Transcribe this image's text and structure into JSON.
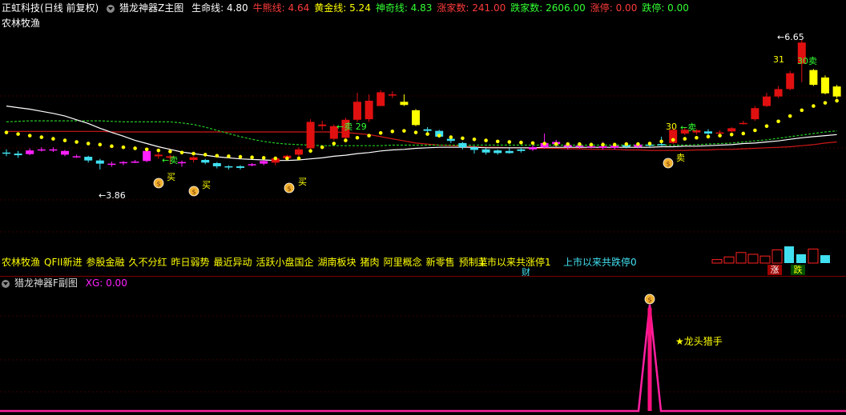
{
  "main_header": {
    "stock": "正虹科技",
    "period": "(日线 前复权)",
    "indicator": "猎龙神器Z主图",
    "items": [
      {
        "text": "生命线: 4.80",
        "color": "#ffffff"
      },
      {
        "text": "牛熊线: 4.64",
        "color": "#ff3b3b"
      },
      {
        "text": "黄金线: 5.24",
        "color": "#ffff00"
      },
      {
        "text": "神奇线: 4.83",
        "color": "#33ff33"
      },
      {
        "text": "涨家数: 241.00",
        "color": "#ff3b3b"
      },
      {
        "text": "跌家数: 2606.00",
        "color": "#33ff33"
      },
      {
        "text": "涨停: 0.00",
        "color": "#ff3b3b"
      },
      {
        "text": "跌停: 0.00",
        "color": "#33ff33"
      }
    ],
    "sector": "农林牧渔"
  },
  "tags": {
    "first": "农林牧渔",
    "concepts": [
      "QFII新进",
      "参股金融",
      "久不分红",
      "昨日弱势",
      "最近异动",
      "活跃小盘国企",
      "湖南板块",
      "猪肉",
      "阿里概念",
      "新零售",
      "预制菜"
    ],
    "limit_up_total": "上市以来共涨停1",
    "limit_down_total": "上市以来共跌停0",
    "cai": "财",
    "zhang": "涨",
    "die": "跌"
  },
  "sub_header": {
    "indicator": "猎龙神器F副图",
    "xg": "XG: 0.00"
  },
  "annotations": {
    "low_price": "←3.86",
    "high_price": "←6.65",
    "sell_29": "←卖 29",
    "sell_30_left": "30",
    "sell_30_left_label": "←卖",
    "sell_30_right": "30卖",
    "num_31": "31",
    "buy": "买",
    "sell_small": "卖",
    "dragon_hunter": "★龙头猎手",
    "money_bag_glyph": "$"
  },
  "colors": {
    "up": "#e01010",
    "down": "#40e0f0",
    "magenta": "#ff20ff",
    "yellow": "#ffff00",
    "white": "#ffffff",
    "green": "#33ff33",
    "red": "#ff2020"
  },
  "chart_data": {
    "type": "candlestick",
    "price_range": [
      3.7,
      6.8
    ],
    "candles": [
      {
        "o": 4.52,
        "c": 4.52,
        "h": 4.58,
        "l": 4.45,
        "k": "down"
      },
      {
        "o": 4.5,
        "c": 4.47,
        "h": 4.55,
        "l": 4.42,
        "k": "down"
      },
      {
        "o": 4.49,
        "c": 4.56,
        "h": 4.6,
        "l": 4.47,
        "k": "magenta"
      },
      {
        "o": 4.56,
        "c": 4.58,
        "h": 4.62,
        "l": 4.54,
        "k": "magenta"
      },
      {
        "o": 4.58,
        "c": 4.56,
        "h": 4.62,
        "l": 4.53,
        "k": "magenta"
      },
      {
        "o": 4.55,
        "c": 4.48,
        "h": 4.57,
        "l": 4.45,
        "k": "magenta"
      },
      {
        "o": 4.45,
        "c": 4.45,
        "h": 4.48,
        "l": 4.42,
        "k": "magenta"
      },
      {
        "o": 4.44,
        "c": 4.37,
        "h": 4.46,
        "l": 4.33,
        "k": "down"
      },
      {
        "o": 4.37,
        "c": 4.31,
        "h": 4.4,
        "l": 4.2,
        "k": "down"
      },
      {
        "o": 4.31,
        "c": 4.31,
        "h": 4.35,
        "l": 4.25,
        "k": "magenta"
      },
      {
        "o": 4.32,
        "c": 4.34,
        "h": 4.36,
        "l": 4.28,
        "k": "magenta"
      },
      {
        "o": 4.35,
        "c": 4.35,
        "h": 4.38,
        "l": 4.32,
        "k": "magenta"
      },
      {
        "o": 4.36,
        "c": 4.55,
        "h": 4.58,
        "l": 4.34,
        "k": "magenta"
      },
      {
        "o": 4.48,
        "c": 4.45,
        "h": 4.52,
        "l": 4.4,
        "k": "up"
      },
      {
        "o": 4.45,
        "c": 4.42,
        "h": 4.48,
        "l": 4.3,
        "k": "up"
      },
      {
        "o": 4.34,
        "c": 4.32,
        "h": 4.37,
        "l": 4.25,
        "k": "magenta"
      },
      {
        "o": 4.38,
        "c": 4.43,
        "h": 4.45,
        "l": 4.33,
        "k": "up"
      },
      {
        "o": 4.38,
        "c": 4.33,
        "h": 4.4,
        "l": 4.3,
        "k": "down"
      },
      {
        "o": 4.32,
        "c": 4.26,
        "h": 4.34,
        "l": 4.22,
        "k": "down"
      },
      {
        "o": 4.26,
        "c": 4.24,
        "h": 4.28,
        "l": 4.2,
        "k": "down"
      },
      {
        "o": 4.23,
        "c": 4.26,
        "h": 4.28,
        "l": 4.2,
        "k": "down"
      },
      {
        "o": 4.28,
        "c": 4.3,
        "h": 4.32,
        "l": 4.26,
        "k": "magenta"
      },
      {
        "o": 4.31,
        "c": 4.36,
        "h": 4.38,
        "l": 4.28,
        "k": "magenta"
      },
      {
        "o": 4.33,
        "c": 4.41,
        "h": 4.43,
        "l": 4.28,
        "k": "up"
      },
      {
        "o": 4.41,
        "c": 4.46,
        "h": 4.48,
        "l": 4.38,
        "k": "up"
      },
      {
        "o": 4.48,
        "c": 4.58,
        "h": 4.62,
        "l": 4.45,
        "k": "up"
      },
      {
        "o": 4.6,
        "c": 5.1,
        "h": 5.15,
        "l": 4.58,
        "k": "up"
      },
      {
        "o": 5.05,
        "c": 5.02,
        "h": 5.12,
        "l": 4.95,
        "k": "up"
      },
      {
        "o": 5.02,
        "c": 4.78,
        "h": 5.05,
        "l": 4.75,
        "k": "up"
      },
      {
        "o": 4.8,
        "c": 5.14,
        "h": 5.18,
        "l": 4.78,
        "k": "up"
      },
      {
        "o": 5.14,
        "c": 5.48,
        "h": 5.65,
        "l": 5.1,
        "k": "up"
      },
      {
        "o": 5.15,
        "c": 5.5,
        "h": 5.62,
        "l": 5.1,
        "k": "up"
      },
      {
        "o": 5.4,
        "c": 5.66,
        "h": 5.7,
        "l": 5.4,
        "k": "up"
      },
      {
        "o": 5.62,
        "c": 5.62,
        "h": 5.68,
        "l": 5.55,
        "k": "up"
      },
      {
        "o": 5.48,
        "c": 5.42,
        "h": 5.62,
        "l": 5.4,
        "k": "yellow"
      },
      {
        "o": 5.32,
        "c": 5.04,
        "h": 5.34,
        "l": 5.02,
        "k": "yellow"
      },
      {
        "o": 4.96,
        "c": 4.93,
        "h": 5.0,
        "l": 4.85,
        "k": "down"
      },
      {
        "o": 4.93,
        "c": 4.82,
        "h": 4.95,
        "l": 4.8,
        "k": "down"
      },
      {
        "o": 4.78,
        "c": 4.74,
        "h": 4.8,
        "l": 4.7,
        "k": "down"
      },
      {
        "o": 4.7,
        "c": 4.62,
        "h": 4.72,
        "l": 4.58,
        "k": "down"
      },
      {
        "o": 4.62,
        "c": 4.57,
        "h": 4.64,
        "l": 4.5,
        "k": "down"
      },
      {
        "o": 4.58,
        "c": 4.52,
        "h": 4.6,
        "l": 4.48,
        "k": "down"
      },
      {
        "o": 4.56,
        "c": 4.51,
        "h": 4.58,
        "l": 4.48,
        "k": "down"
      },
      {
        "o": 4.51,
        "c": 4.55,
        "h": 4.6,
        "l": 4.5,
        "k": "down"
      },
      {
        "o": 4.55,
        "c": 4.58,
        "h": 4.62,
        "l": 4.52,
        "k": "down"
      },
      {
        "o": 4.58,
        "c": 4.62,
        "h": 4.66,
        "l": 4.55,
        "k": "magenta"
      },
      {
        "o": 4.62,
        "c": 4.7,
        "h": 4.88,
        "l": 4.6,
        "k": "magenta"
      },
      {
        "o": 4.72,
        "c": 4.68,
        "h": 4.76,
        "l": 4.63,
        "k": "magenta"
      },
      {
        "o": 4.66,
        "c": 4.63,
        "h": 4.7,
        "l": 4.58,
        "k": "magenta"
      },
      {
        "o": 4.64,
        "c": 4.65,
        "h": 4.7,
        "l": 4.6,
        "k": "magenta"
      },
      {
        "o": 4.64,
        "c": 4.64,
        "h": 4.68,
        "l": 4.6,
        "k": "magenta"
      },
      {
        "o": 4.64,
        "c": 4.61,
        "h": 4.72,
        "l": 4.58,
        "k": "magenta"
      },
      {
        "o": 4.61,
        "c": 4.65,
        "h": 4.68,
        "l": 4.58,
        "k": "magenta"
      },
      {
        "o": 4.66,
        "c": 4.63,
        "h": 4.7,
        "l": 4.6,
        "k": "down"
      },
      {
        "o": 4.63,
        "c": 4.67,
        "h": 4.7,
        "l": 4.6,
        "k": "magenta"
      },
      {
        "o": 4.67,
        "c": 4.65,
        "h": 4.72,
        "l": 4.62,
        "k": "down"
      },
      {
        "o": 4.66,
        "c": 4.68,
        "h": 4.82,
        "l": 4.65,
        "k": "down"
      },
      {
        "o": 4.7,
        "c": 4.95,
        "h": 5.0,
        "l": 4.68,
        "k": "up"
      },
      {
        "o": 4.95,
        "c": 4.88,
        "h": 5.0,
        "l": 4.85,
        "k": "up"
      },
      {
        "o": 4.9,
        "c": 4.94,
        "h": 4.96,
        "l": 4.86,
        "k": "up"
      },
      {
        "o": 4.92,
        "c": 4.88,
        "h": 4.96,
        "l": 4.84,
        "k": "down"
      },
      {
        "o": 4.9,
        "c": 4.9,
        "h": 4.94,
        "l": 4.86,
        "k": "up"
      },
      {
        "o": 4.92,
        "c": 4.98,
        "h": 5.0,
        "l": 4.9,
        "k": "up"
      },
      {
        "o": 5.08,
        "c": 5.08,
        "h": 5.12,
        "l": 5.05,
        "k": "up"
      },
      {
        "o": 5.15,
        "c": 5.36,
        "h": 5.4,
        "l": 5.12,
        "k": "up"
      },
      {
        "o": 5.4,
        "c": 5.58,
        "h": 5.65,
        "l": 5.38,
        "k": "up"
      },
      {
        "o": 5.58,
        "c": 5.72,
        "h": 5.78,
        "l": 5.55,
        "k": "up"
      },
      {
        "o": 5.72,
        "c": 6.02,
        "h": 6.06,
        "l": 5.7,
        "k": "up"
      },
      {
        "o": 6.2,
        "c": 6.6,
        "h": 6.65,
        "l": 5.85,
        "k": "up"
      },
      {
        "o": 6.08,
        "c": 5.8,
        "h": 6.1,
        "l": 5.78,
        "k": "yellow"
      },
      {
        "o": 5.94,
        "c": 5.64,
        "h": 5.98,
        "l": 5.62,
        "k": "yellow"
      },
      {
        "o": 5.77,
        "c": 5.58,
        "h": 5.8,
        "l": 5.55,
        "k": "yellow"
      }
    ],
    "lines": {
      "life_white": [
        5.4,
        5.37,
        5.34,
        5.3,
        5.26,
        5.21,
        5.14,
        5.07,
        4.98,
        4.9,
        4.83,
        4.75,
        4.69,
        4.63,
        4.58,
        4.53,
        4.5,
        4.47,
        4.44,
        4.42,
        4.4,
        4.39,
        4.38,
        4.37,
        4.37,
        4.38,
        4.4,
        4.42,
        4.45,
        4.47,
        4.5,
        4.52,
        4.55,
        4.57,
        4.58,
        4.6,
        4.61,
        4.62,
        4.62,
        4.62,
        4.62,
        4.61,
        4.61,
        4.61,
        4.61,
        4.61,
        4.62,
        4.62,
        4.62,
        4.62,
        4.62,
        4.62,
        4.62,
        4.62,
        4.62,
        4.62,
        4.63,
        4.63,
        4.64,
        4.64,
        4.65,
        4.66,
        4.67,
        4.69,
        4.7,
        4.72,
        4.74,
        4.77,
        4.8,
        4.82,
        4.84,
        4.86
      ],
      "bull_bear_red": [
        4.92,
        4.92,
        4.92,
        4.92,
        4.92,
        4.92,
        4.92,
        4.92,
        4.92,
        4.91,
        4.91,
        4.91,
        4.91,
        4.91,
        4.91,
        4.91,
        4.91,
        4.91,
        4.91,
        4.91,
        4.91,
        4.91,
        4.91,
        4.91,
        4.91,
        4.91,
        4.91,
        4.91,
        4.91,
        4.9,
        4.88,
        4.86,
        4.82,
        4.78,
        4.74,
        4.7,
        4.68,
        4.66,
        4.65,
        4.64,
        4.63,
        4.62,
        4.62,
        4.61,
        4.61,
        4.6,
        4.6,
        4.6,
        4.59,
        4.59,
        4.58,
        4.58,
        4.58,
        4.57,
        4.57,
        4.56,
        4.56,
        4.56,
        4.56,
        4.57,
        4.57,
        4.58,
        4.58,
        4.59,
        4.6,
        4.61,
        4.62,
        4.63,
        4.65,
        4.67,
        4.7,
        4.72
      ],
      "gold_dots": [
        4.9,
        4.87,
        4.84,
        4.81,
        4.78,
        4.75,
        4.72,
        4.69,
        4.67,
        4.64,
        4.62,
        4.6,
        4.58,
        4.56,
        4.54,
        4.52,
        4.5,
        4.48,
        4.46,
        4.45,
        4.44,
        4.43,
        4.42,
        4.41,
        4.41,
        4.41,
        4.55,
        4.62,
        4.69,
        4.75,
        4.8,
        4.84,
        4.89,
        4.92,
        4.93,
        4.9,
        4.87,
        4.84,
        4.81,
        4.79,
        4.77,
        4.75,
        4.73,
        4.72,
        4.71,
        4.7,
        4.69,
        4.68,
        4.68,
        4.68,
        4.67,
        4.67,
        4.67,
        4.68,
        4.68,
        4.69,
        4.73,
        4.76,
        4.78,
        4.8,
        4.82,
        4.84,
        4.86,
        4.88,
        4.94,
        5.02,
        5.11,
        5.21,
        5.32,
        5.4,
        5.46,
        5.5
      ],
      "magic_green_dash": [
        5.1,
        5.11,
        5.12,
        5.12,
        5.12,
        5.12,
        5.12,
        5.12,
        5.12,
        5.11,
        5.1,
        5.1,
        5.1,
        5.1,
        5.1,
        5.08,
        5.05,
        5.0,
        4.94,
        4.88,
        4.82,
        4.77,
        4.73,
        4.7,
        4.68,
        4.67,
        4.66,
        4.65,
        4.65,
        4.65,
        4.65,
        4.65,
        4.65,
        4.66,
        4.66,
        4.66,
        4.66,
        4.66,
        4.66,
        4.66,
        4.66,
        4.66,
        4.66,
        4.66,
        4.66,
        4.66,
        4.66,
        4.66,
        4.66,
        4.66,
        4.66,
        4.66,
        4.66,
        4.66,
        4.66,
        4.66,
        4.66,
        4.66,
        4.66,
        4.67,
        4.68,
        4.69,
        4.7,
        4.72,
        4.74,
        4.76,
        4.79,
        4.82,
        4.85,
        4.88,
        4.91,
        4.93
      ]
    },
    "volume_bars": [
      {
        "v": 0.2,
        "k": "up"
      },
      {
        "v": 0.35,
        "k": "up"
      },
      {
        "v": 0.6,
        "k": "up"
      },
      {
        "v": 0.5,
        "k": "up"
      },
      {
        "v": 0.4,
        "k": "up"
      },
      {
        "v": 0.75,
        "k": "up"
      },
      {
        "v": 0.95,
        "k": "down"
      },
      {
        "v": 0.5,
        "k": "down"
      },
      {
        "v": 0.8,
        "k": "up"
      },
      {
        "v": 0.45,
        "k": "down"
      }
    ],
    "sub_spike_center_index": 54
  }
}
